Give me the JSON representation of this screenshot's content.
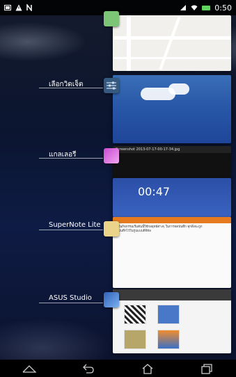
{
  "status_bar": {
    "time": "0:50",
    "icons": [
      "image-icon",
      "warning-icon",
      "signal-icon",
      "nfc-icon",
      "wifi-icon",
      "battery-icon"
    ]
  },
  "recent_apps": [
    {
      "label": "",
      "icon": "maps-icon"
    },
    {
      "label": "เลือกวิดเจ็ต",
      "icon": "widget-settings-icon"
    },
    {
      "label": "แกลเลอรี",
      "icon": "gallery-icon"
    },
    {
      "label": "SuperNote Lite",
      "icon": "supernote-icon"
    },
    {
      "label": "ASUS Studio",
      "icon": "asus-studio-icon"
    }
  ],
  "previews": {
    "gallery_filename": "Screenshot 2013-07-17-00-17-34.jpg",
    "home_clock": "00:47",
    "note_text": "ในกิจกรรมเริ่มต้นนี้ใช้กลยุทธ์ต่างๆ ในการจดบันทึก ทุกสิ่งจะถูกบันทึกไว้ในรูปแบบดิจิทัล"
  },
  "nav_bar": {
    "buttons": [
      "recent-apps-up",
      "back",
      "home",
      "recent-apps"
    ]
  },
  "colors": {
    "wallpaper": "#0e1b44",
    "note_accent": "#e57a1f",
    "battery": "#5fd45f"
  }
}
